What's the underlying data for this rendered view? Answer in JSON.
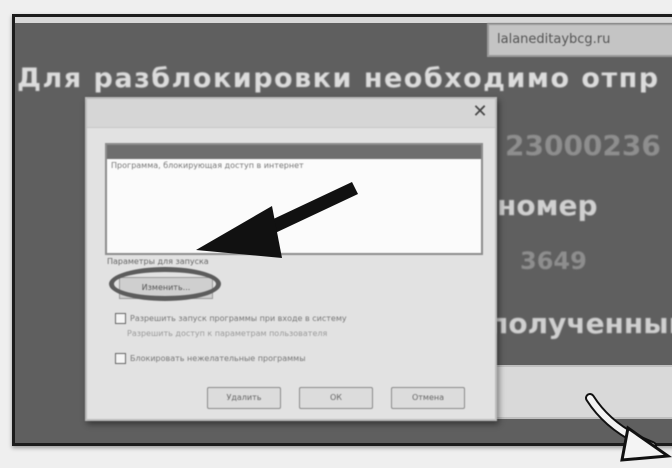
{
  "background": {
    "url_box_text": "lalaneditaybcg.ru",
    "banner_text": "Для разблокировки необходимо отпр",
    "code_text": "23000236",
    "number_text": "номер",
    "short_code_text": "3649",
    "received_text": "полученный"
  },
  "dialog": {
    "close_glyph": "✕",
    "list_row_text": "Программа, блокирующая доступ в интернет",
    "label_text": "Параметры для запуска",
    "circled_button_label": "Изменить...",
    "check1_label": "Разрешить запуск программы при входе в систему",
    "check2_label": "Разрешить доступ к параметрам пользователя",
    "check3_label": "Блокировать нежелательные программы",
    "buttons": [
      "Удалить",
      "ОК",
      "Отмена"
    ]
  },
  "colors": {
    "screen_bg": "#5f5f5f",
    "dialog_bg": "#e2e2e2",
    "annotation": "#111111"
  }
}
